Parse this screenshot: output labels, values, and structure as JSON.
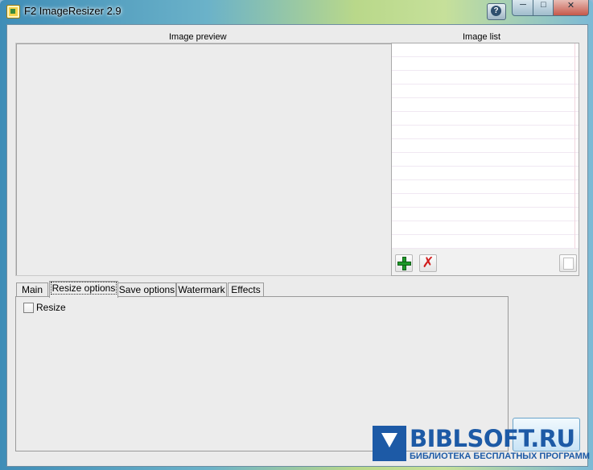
{
  "window": {
    "title": "F2 ImageResizer 2.9",
    "icons": {
      "app": "app-icon",
      "help": "help-icon",
      "minimize": "minimize-icon",
      "maximize": "maximize-icon",
      "close": "close-icon"
    }
  },
  "preview": {
    "label": "Image preview"
  },
  "image_list": {
    "label": "Image list",
    "buttons": [
      {
        "name": "add",
        "icon": "plus-icon"
      },
      {
        "name": "remove",
        "icon": "x-icon"
      },
      {
        "name": "blank",
        "icon": "page-icon"
      }
    ]
  },
  "tabs": [
    {
      "label": "Main"
    },
    {
      "label": "Resize options",
      "active": true
    },
    {
      "label": "Save options"
    },
    {
      "label": "Watermark"
    },
    {
      "label": "Effects"
    }
  ],
  "resize_options": {
    "resize_label": "Resize",
    "resize_checked": false
  },
  "watermark": {
    "title": "BIBLSOFT.RU",
    "subtitle": "БИБЛИОТЕКА БЕСПЛАТНЫХ ПРОГРАММ"
  }
}
